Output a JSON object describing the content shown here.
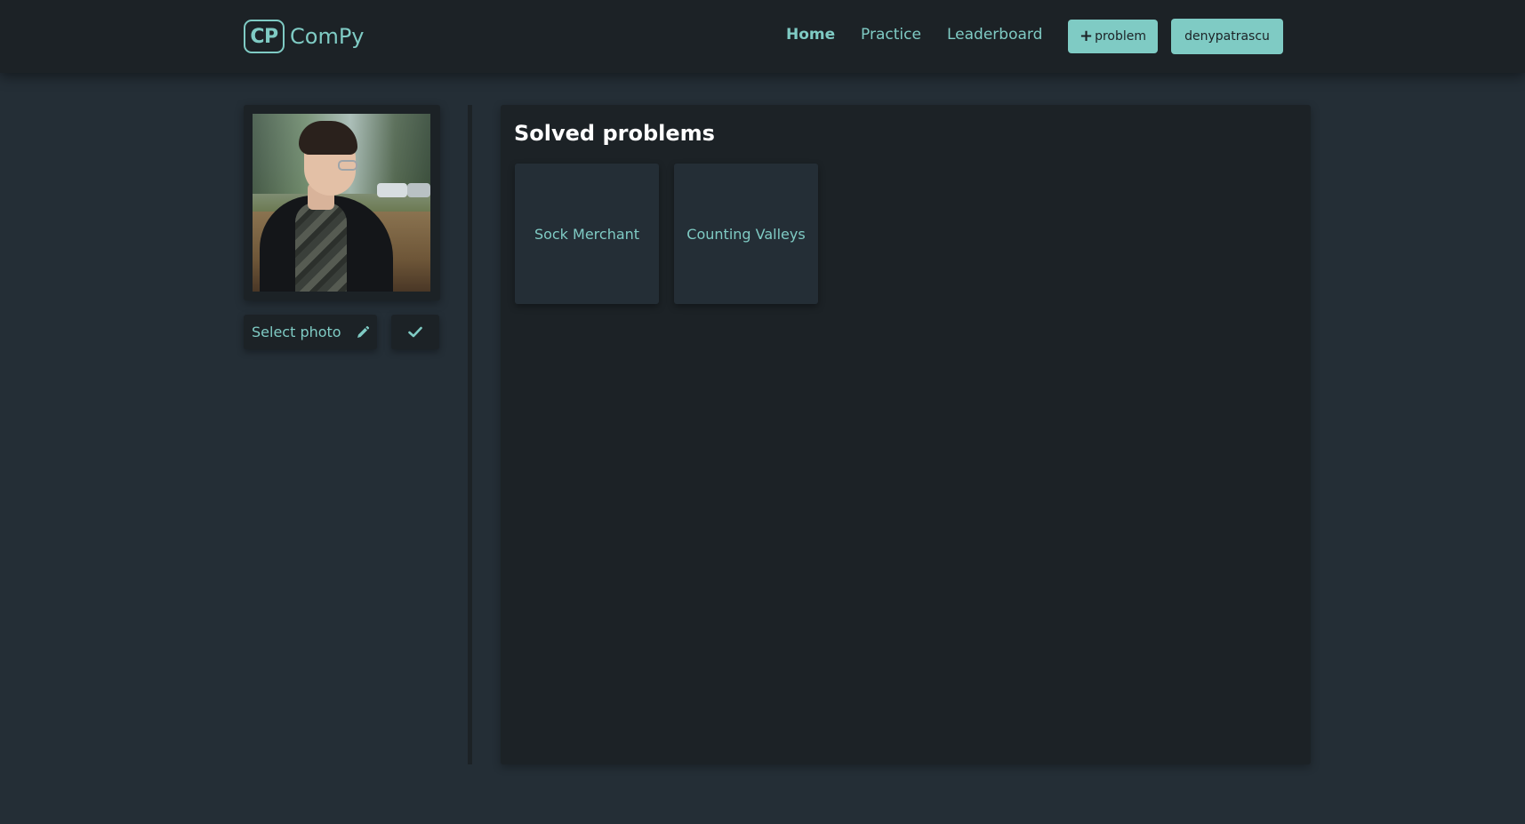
{
  "brand": {
    "logo_mark": "CP",
    "name": "ComPy"
  },
  "nav": {
    "links": [
      {
        "label": "Home",
        "active": true
      },
      {
        "label": "Practice",
        "active": false
      },
      {
        "label": "Leaderboard",
        "active": false
      }
    ],
    "add_problem_label": "problem",
    "add_problem_icon": "plus-icon",
    "user_label": "denypatrascu"
  },
  "profile": {
    "photo_alt": "profile photo",
    "select_photo_label": "Select photo",
    "select_photo_icon": "pencil-icon",
    "confirm_icon": "check-icon"
  },
  "solved": {
    "title": "Solved problems",
    "problems": [
      {
        "label": "Sock Merchant"
      },
      {
        "label": "Counting Valleys"
      }
    ]
  },
  "colors": {
    "accent": "#7fcbc4",
    "background": "#242e36",
    "surface": "#1c2226",
    "title_text": "#ffffff"
  }
}
